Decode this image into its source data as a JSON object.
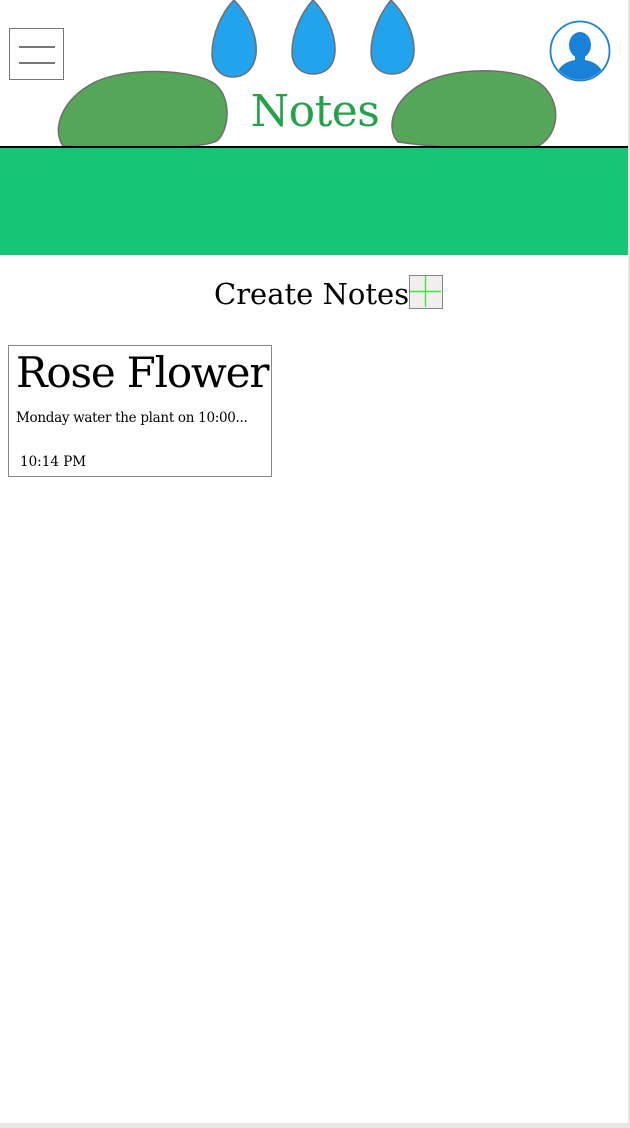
{
  "header": {
    "title": "Notes",
    "menu_icon": "hamburger-menu-icon",
    "profile_icon": "user-avatar-icon",
    "decoration": [
      "water-drop-icon",
      "water-drop-icon",
      "water-drop-icon",
      "bush-icon",
      "bush-icon"
    ]
  },
  "create": {
    "label": "Create Notes",
    "icon": "plus-icon"
  },
  "notes": [
    {
      "title": "Rose Flower",
      "preview": "Monday water the plant on 10:00...",
      "time": "10:14 PM"
    }
  ],
  "colors": {
    "accent_green": "#24a24a",
    "banner_green": "#16c576",
    "water_blue": "#22a3ee",
    "bush_green": "#56a65a",
    "profile_blue": "#1a82d6",
    "plus_green": "#33ee33"
  }
}
